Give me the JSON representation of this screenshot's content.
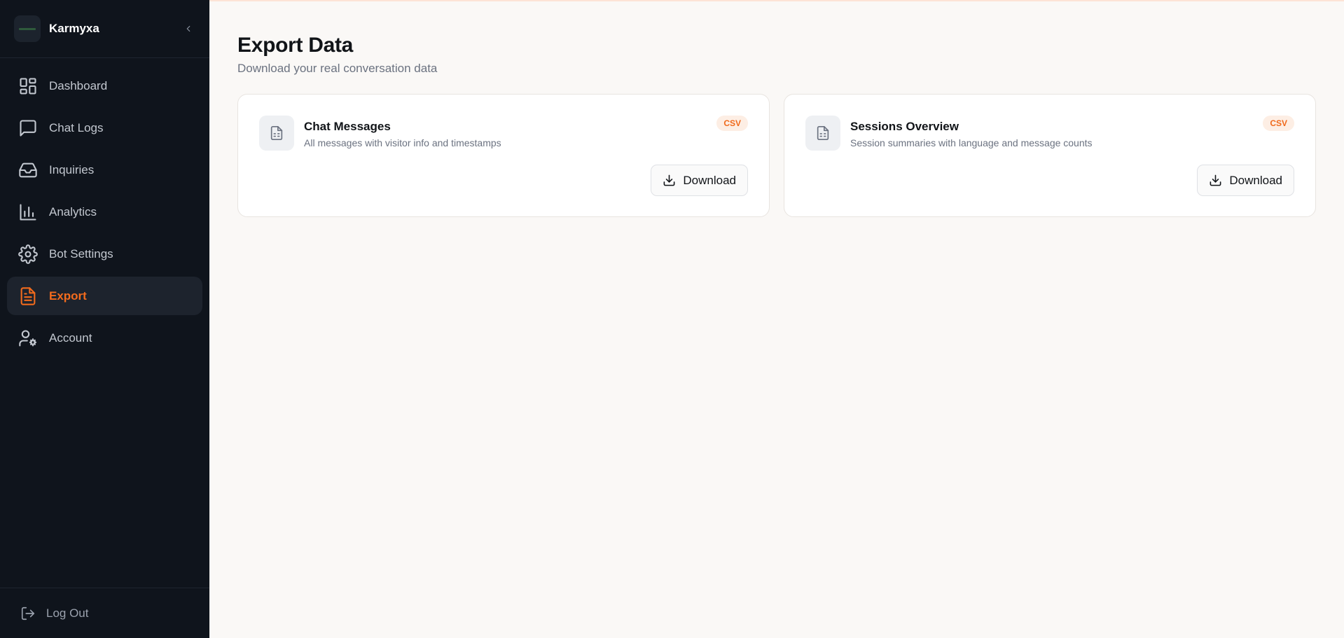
{
  "brand": {
    "name": "Karmyxa"
  },
  "sidebar": {
    "items": [
      {
        "label": "Dashboard",
        "icon": "layout-grid-icon"
      },
      {
        "label": "Chat Logs",
        "icon": "message-square-icon"
      },
      {
        "label": "Inquiries",
        "icon": "inbox-icon"
      },
      {
        "label": "Analytics",
        "icon": "bar-chart-icon"
      },
      {
        "label": "Bot Settings",
        "icon": "gear-icon"
      },
      {
        "label": "Export",
        "icon": "file-text-icon",
        "active": true
      },
      {
        "label": "Account",
        "icon": "user-cog-icon"
      }
    ],
    "logout_label": "Log Out"
  },
  "main": {
    "title": "Export Data",
    "subtitle": "Download your real conversation data",
    "cards": [
      {
        "title": "Chat Messages",
        "description": "All messages with visitor info and timestamps",
        "badge": "CSV",
        "button_label": "Download"
      },
      {
        "title": "Sessions Overview",
        "description": "Session summaries with language and message counts",
        "badge": "CSV",
        "button_label": "Download"
      }
    ]
  },
  "colors": {
    "sidebar_bg": "#0f141c",
    "accent": "#f26b1d",
    "page_bg": "#faf8f6"
  }
}
